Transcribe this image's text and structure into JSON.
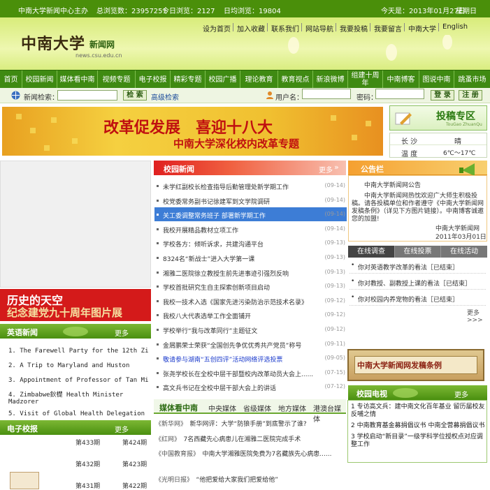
{
  "topbar": {
    "host": "中南大学新闻中心主办",
    "total": "总浏览数：23957251",
    "today": "今日浏览：2127",
    "daily": "日均浏览：19804",
    "date": "今天是：2013年01月27日",
    "weekday": "星期日"
  },
  "header": {
    "logo": "中南大学",
    "logo_sub": "新闻网",
    "logo_url": "news.csu.edu.cn",
    "links": [
      "设为首页",
      "加入收藏",
      "联系我们",
      "网站导航",
      "我要投稿",
      "我要留言",
      "中南大学",
      "English"
    ]
  },
  "nav": [
    "首页",
    "校园新闻",
    "媒体看中南",
    "视频专题",
    "电子校报",
    "精彩专题",
    "校园广播",
    "理论教育",
    "教育视点",
    "新浪微博",
    "组建十周年",
    "中南博客",
    "图说中南",
    "跳蚤市场"
  ],
  "search": {
    "label": "新闻检索：",
    "btn": "检 索",
    "adv": "高级检索",
    "user": "用户名：",
    "pwd": "密码：",
    "login": "登 录",
    "reg": "注 册"
  },
  "banner": {
    "line1": "改革促发展　喜迎十八大",
    "line2": "中南大学深化校内改革专题"
  },
  "tougao": {
    "title": "投稿专区",
    "sub": "TouGao ZhuanQu"
  },
  "weather": {
    "city": "长 沙",
    "cond": "晴",
    "temp_label": "温 度",
    "temp": "6℃～17℃"
  },
  "left": {
    "photo_line1": "历史的天空",
    "photo_line2": "纪念建党九十周年图片展",
    "eng_title": "英语新闻",
    "more": "更多",
    "eng_news": [
      "1. The Farewell Party for the 12th Zim",
      "2. A Trip to Maryland and Huston",
      "3. Appointment of Professor of Tan Min",
      "4. Zimbabwe鈥檚 Health Minister Madzorer",
      "5. Visit of Global Health Delegation o"
    ],
    "paper_title": "电子校报",
    "paper_issues": [
      "第433期",
      "第424期",
      "第432期",
      "第423期",
      "第431期",
      "第422期"
    ]
  },
  "campus": {
    "title": "校园新闻",
    "more": "更多",
    "items": [
      {
        "t": "未学红副校长检查指导后勤管理处新学期工作",
        "d": "(09-14)"
      },
      {
        "t": "校党委常务副书记徐建军到文学院调研",
        "d": "(09-14)"
      },
      {
        "t": "关工委调整常务班子 部署新学期工作",
        "d": "(09-14)"
      },
      {
        "t": "我校开展精品教材立项工作",
        "d": "(09-14)"
      },
      {
        "t": "学校各方：倾听诉求，共建沟通平台",
        "d": "(09-13)"
      },
      {
        "t": "8324名“新战士”进入大学第一课",
        "d": "(09-13)"
      },
      {
        "t": "湘雅二医院徐立教授生前先进事迹引强烈反响",
        "d": "(09-13)"
      },
      {
        "t": "学校首批研究生自主探索创新项目启动",
        "d": "(09-13)"
      },
      {
        "t": "我校一技术入选《国家先进污染防治示范技术名录》",
        "d": "(09-12)"
      },
      {
        "t": "我校八大代表选举工作全面铺开",
        "d": "(09-12)"
      },
      {
        "t": "学校举行“我与改革同行”主题征文",
        "d": "(09-12)"
      },
      {
        "t": "金屑鹏荣士荣获“全国创先争优优秀共产党员”称号",
        "d": "(09-11)"
      },
      {
        "t": "敬请参与湖南“五创四评”活动网络评选投票",
        "d": "(09-05)"
      },
      {
        "t": "张尧学校长在全校中层干部暨校内改革动员大会上......",
        "d": "(07-15)"
      },
      {
        "t": "高文兵书记在全校中层干部大会上的讲话",
        "d": "(07-12)"
      }
    ]
  },
  "media": {
    "title": "媒体看中南",
    "tabs": [
      "中央媒体",
      "省级媒体",
      "地方媒体",
      "港澳台媒体"
    ],
    "items": [
      {
        "s": "《新华网》",
        "t": "新华网评：大学“防狼手册”到底警示了谁?"
      },
      {
        "s": "《红网》",
        "t": "7名西藏先心病患儿在湘雅二医院完成手术"
      },
      {
        "s": "《中国教育报》",
        "t": "中南大学湘雅医院免费为7名藏族先心病患......"
      },
      {
        "s": "《光明日报》",
        "t": "“他把爱给大家我们把爱给他”"
      }
    ]
  },
  "notice": {
    "title": "公告栏",
    "body": "中南大学新闻网热忱欢迎广大师生积极投稿。请各投稿单位和作者遵守《中南大学新闻网发稿条例》（详见下方图片链接）。中南博客诚邀您的加盟!",
    "sign1": "中南大学新闻网",
    "sign2": "2011年03月01日"
  },
  "vote": {
    "tabs": [
      "在线调查",
      "在线投票",
      "在线活动"
    ],
    "items": [
      "你对英语教学改革的看法［已结束］",
      "你对教授、副教授上课的看法［已结束］",
      "你对校园内养宠物的看法［已结束］"
    ],
    "more": "更多>>>"
  },
  "rule_banner": "中南大学新闻网发稿条例",
  "tv": {
    "title": "校园电视",
    "more": "更多",
    "items": [
      "1  专访高文兵：建中南文化百年基业 留历届校友反哺之情",
      "2  中南教育基金募捐倡议书 中南全营募捐倡议书",
      "3  学校启动“新目录”一级学科学位授权点对应调整工作"
    ]
  }
}
